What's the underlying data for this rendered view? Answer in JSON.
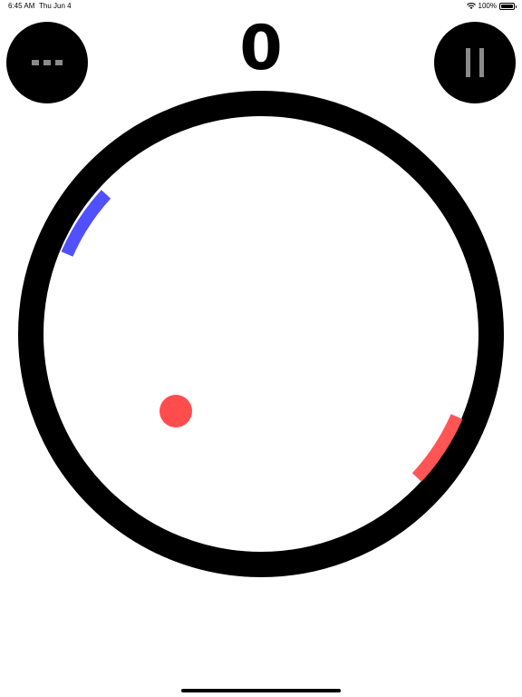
{
  "status_bar": {
    "time": "6:45 AM",
    "date": "Thu Jun 4",
    "battery": "100%",
    "battery_level": 1.0,
    "icons": [
      "wifi-icon",
      "battery-icon"
    ]
  },
  "score": "0",
  "buttons": {
    "menu_icon": "ellipsis-icon",
    "pause_icon": "pause-icon"
  },
  "game": {
    "ring_color": "#000000",
    "player_paddle_color": "#5050ff",
    "opponent_paddle_color": "#ff5555",
    "ball_color": "#ff4d4d",
    "button_color": "#000000",
    "button_glyph_color": "#8a8a8a"
  }
}
